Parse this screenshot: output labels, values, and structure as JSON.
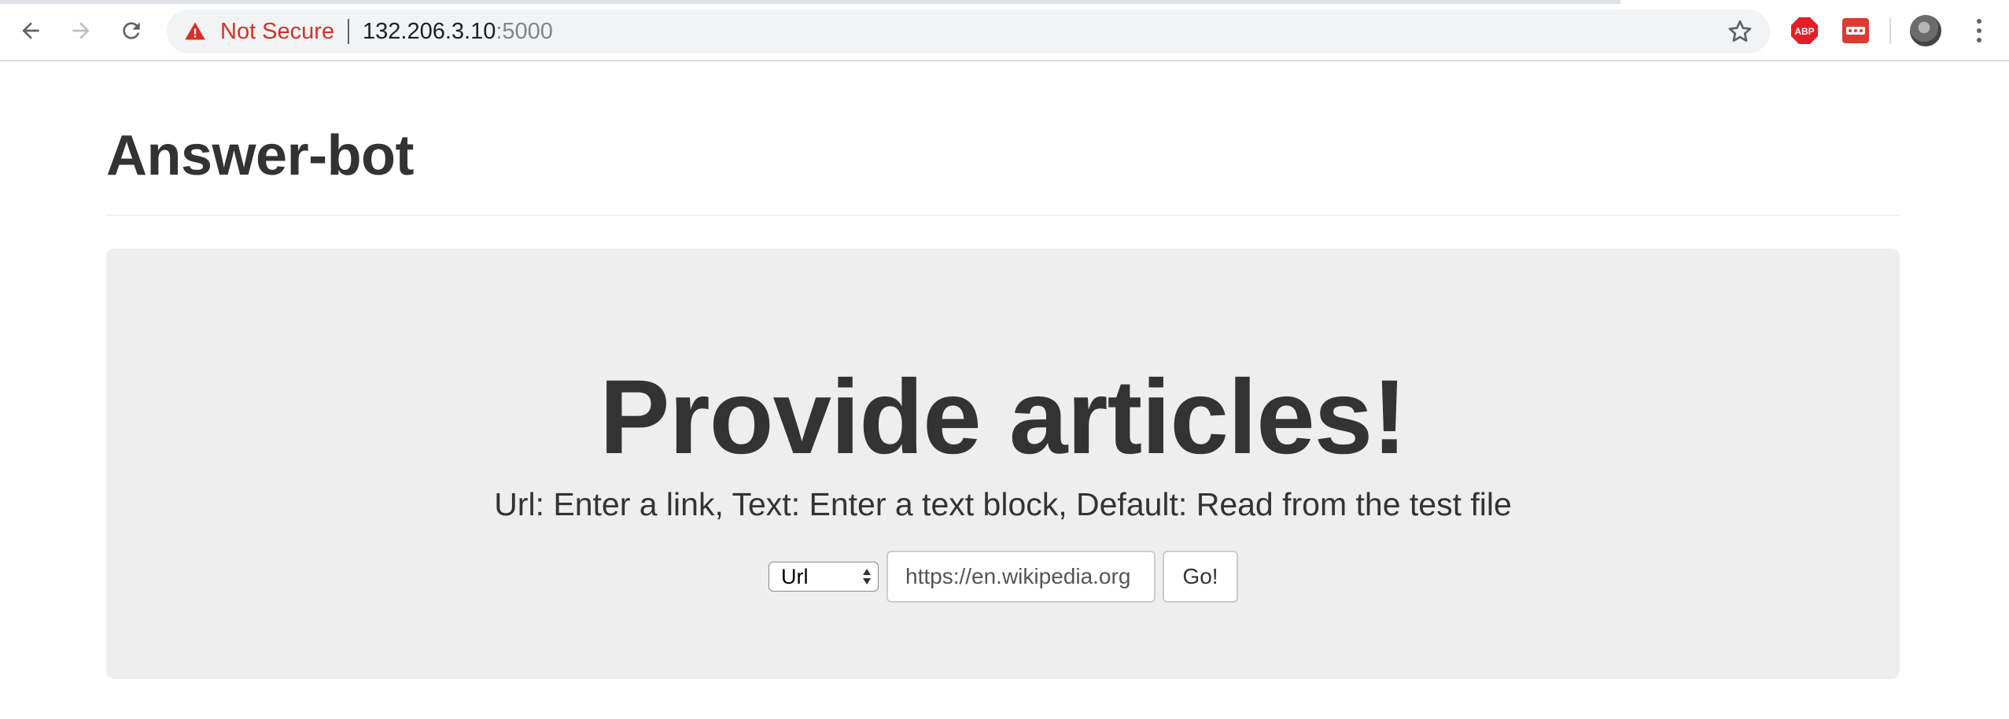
{
  "browser": {
    "security_label": "Not Secure",
    "url_host": "132.206.3.10",
    "url_port": ":5000",
    "icons": {
      "back": "back-arrow-icon",
      "forward": "forward-arrow-icon",
      "reload": "reload-icon",
      "warning": "warning-triangle-icon",
      "bookmark": "star-icon",
      "adblock": "adblock-plus-icon",
      "extension": "red-extension-icon",
      "profile": "avatar",
      "menu": "kebab-menu-icon"
    },
    "adblock_badge": "ABP",
    "colors": {
      "not_secure": "#d93025",
      "omnibox_bg": "#f1f3f4",
      "adblock_red": "#e41e26"
    }
  },
  "page": {
    "title": "Answer-bot",
    "jumbotron": {
      "heading": "Provide articles!",
      "subtext": "Url: Enter a link, Text: Enter a text block, Default: Read from the test file",
      "background": "#eeeeee"
    },
    "form": {
      "select_value": "Url",
      "input_value": "https://en.wikipedia.org",
      "submit_label": "Go!"
    }
  }
}
